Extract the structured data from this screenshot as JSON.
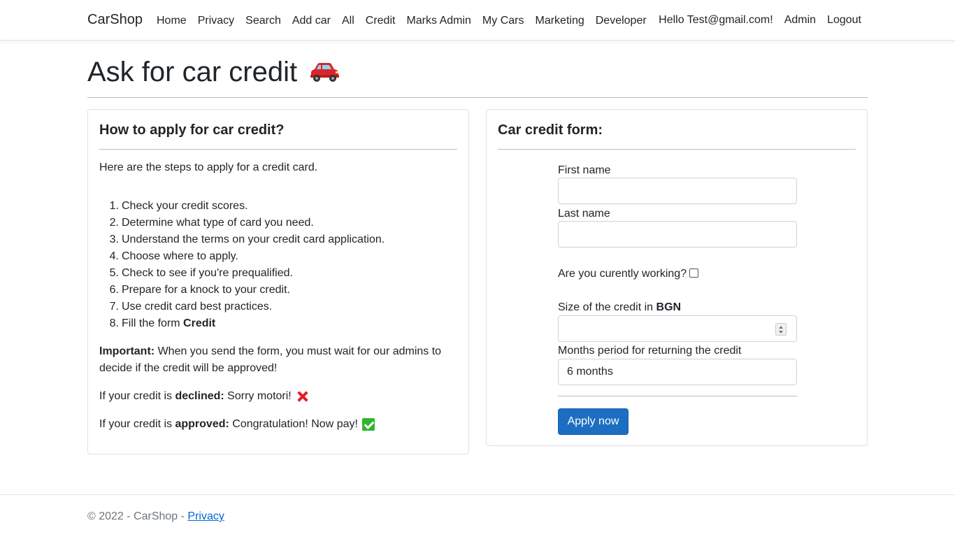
{
  "navbar": {
    "brand": "CarShop",
    "links": [
      "Home",
      "Privacy",
      "Search",
      "Add car",
      "All",
      "Credit",
      "Marks Admin",
      "My Cars",
      "Marketing",
      "Developer"
    ],
    "greeting": "Hello Test@gmail.com!",
    "admin": "Admin",
    "logout": "Logout"
  },
  "page": {
    "title": "Ask for car credit"
  },
  "info": {
    "heading": "How to apply for car credit?",
    "intro": "Here are the steps to apply for a credit card.",
    "steps": [
      {
        "num": "1.",
        "text": "Check your credit scores."
      },
      {
        "num": "2.",
        "text": "Determine what type of card you need."
      },
      {
        "num": "3.",
        "text": "Understand the terms on your credit card application."
      },
      {
        "num": "4.",
        "text": "Choose where to apply."
      },
      {
        "num": "5.",
        "text": "Check to see if you're prequalified."
      },
      {
        "num": "6.",
        "text": "Prepare for a knock to your credit."
      },
      {
        "num": "7.",
        "text": "Use credit card best practices."
      },
      {
        "num": "8.",
        "text": "Fill the form",
        "bold": "Credit"
      }
    ],
    "important_label": "Important:",
    "important_text": "When you send the form, you must wait for our admins to decide if the credit will be approved!",
    "declined_prefix": "If your credit is",
    "declined_label": "declined:",
    "declined_text": "Sorry motori!",
    "approved_prefix": "If your credit is",
    "approved_label": "approved:",
    "approved_text": "Congratulation! Now pay!"
  },
  "form": {
    "heading": "Car credit form:",
    "first_name_label": "First name",
    "first_name_value": "",
    "last_name_label": "Last name",
    "last_name_value": "",
    "working_label": "Are you curently working?",
    "working_checked": false,
    "credit_size_label": "Size of the credit in",
    "credit_size_currency": "BGN",
    "credit_size_value": "",
    "months_label": "Months period for returning the credit",
    "months_value": "6 months",
    "submit_label": "Apply now"
  },
  "footer": {
    "copyright": "© 2022 - CarShop -",
    "privacy_link": "Privacy"
  },
  "colors": {
    "primary_button": "#1b6ec2",
    "link": "#0366d6",
    "footer_text": "#6c757d"
  }
}
